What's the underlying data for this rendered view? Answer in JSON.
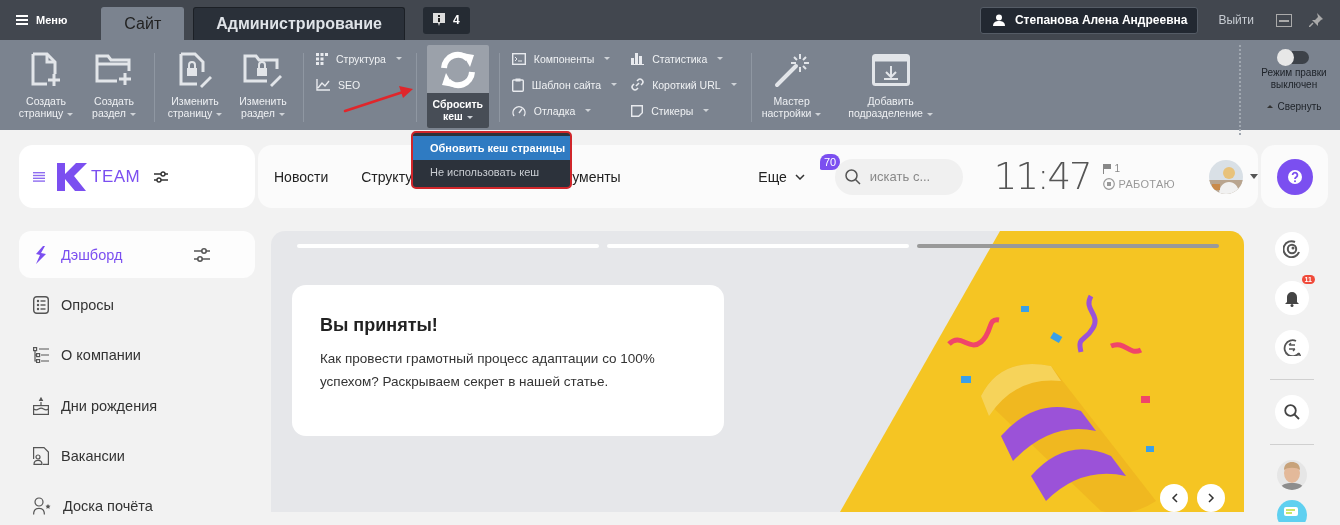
{
  "topbar": {
    "menu": "Меню",
    "tabs": [
      {
        "label": "Сайт",
        "selected": true
      },
      {
        "label": "Администрирование",
        "selected": false
      }
    ],
    "notifications": "4",
    "user": "Степанова Алена Андреевна",
    "logout": "Выйти"
  },
  "toolbar": {
    "groups": [
      {
        "kind": "large",
        "items": [
          {
            "label": "Создать страницу",
            "menu": true,
            "active": false
          },
          {
            "label": "Создать раздел",
            "menu": true,
            "active": false
          }
        ]
      },
      {
        "kind": "large",
        "items": [
          {
            "label": "Изменить страницу",
            "menu": true,
            "active": false
          },
          {
            "label": "Изменить раздел",
            "menu": true,
            "active": false
          }
        ]
      },
      {
        "kind": "small",
        "items": [
          {
            "label": "Структура",
            "menu": true
          },
          {
            "label": "SEO",
            "menu": false
          }
        ]
      },
      {
        "kind": "large",
        "items": [
          {
            "label": "Сбросить кеш",
            "menu": true,
            "active": true
          }
        ]
      },
      {
        "kind": "small",
        "items": [
          {
            "label": "Компоненты",
            "menu": true
          },
          {
            "label": "Шаблон сайта",
            "menu": true
          },
          {
            "label": "Отладка",
            "menu": true
          }
        ]
      },
      {
        "kind": "small",
        "items": [
          {
            "label": "Статистика",
            "menu": true
          },
          {
            "label": "Короткий URL",
            "menu": true
          },
          {
            "label": "Стикеры",
            "menu": true
          }
        ]
      },
      {
        "kind": "large",
        "items": [
          {
            "label": "Мастер настройки",
            "menu": true,
            "active": false
          },
          {
            "label": "Добавить подразделение",
            "menu": true,
            "active": false
          }
        ]
      }
    ],
    "edit_mode": {
      "label": "Режим правки выключен",
      "on": false
    },
    "collapse": "Свернуть"
  },
  "cache_menu": {
    "arrow": true,
    "highlighted": true,
    "items": [
      {
        "label": "Обновить кеш страницы",
        "selected": true
      },
      {
        "label": "Не использовать кеш",
        "selected": false
      }
    ]
  },
  "header": {
    "logo": "TEAM",
    "nav": [
      "Новости",
      "Структу",
      "ументы"
    ],
    "more": {
      "label": "Еще",
      "badge": "70"
    },
    "search": {
      "placeholder": "искать с..."
    },
    "clock": "11:47",
    "flag_count": "1",
    "status": "РАБОТАЮ"
  },
  "sidebar": {
    "items": [
      {
        "label": "Дэшборд",
        "selected": true
      },
      {
        "label": "Опросы",
        "selected": false
      },
      {
        "label": "О компании",
        "selected": false
      },
      {
        "label": "Дни рождения",
        "selected": false
      },
      {
        "label": "Вакансии",
        "selected": false
      },
      {
        "label": "Доска почёта",
        "selected": false
      }
    ]
  },
  "banner": {
    "slides": [
      {
        "selected": false
      },
      {
        "selected": false
      },
      {
        "selected": true
      }
    ],
    "title": "Вы приняты!",
    "text": "Как провести грамотный процесс адаптации со 100% успехом? Раскрываем секрет в нашей статье."
  },
  "rail": {
    "notification_count": "11"
  }
}
